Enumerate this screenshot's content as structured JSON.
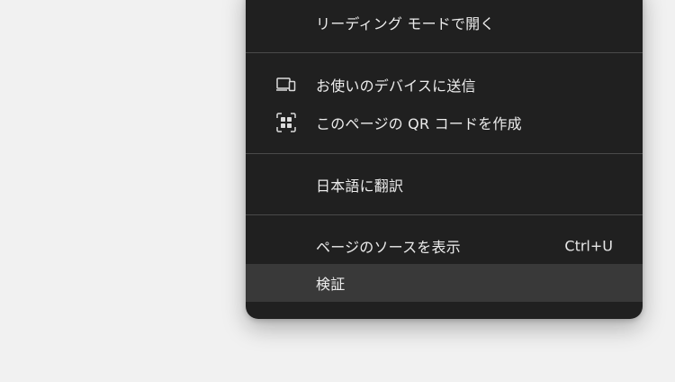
{
  "menu": {
    "items": [
      {
        "label": "リーディング モードで開く"
      },
      {
        "label": "お使いのデバイスに送信",
        "icon": "send-to-devices-icon"
      },
      {
        "label": "このページの QR コードを作成",
        "icon": "qr-code-icon"
      },
      {
        "label": "日本語に翻訳"
      },
      {
        "label": "ページのソースを表示",
        "shortcut": "Ctrl+U"
      },
      {
        "label": "検証"
      }
    ]
  },
  "colors": {
    "background": "#f1f1f1",
    "menu_background": "#202020",
    "hover": "#393939",
    "separator": "#4a4a4a",
    "text": "#ececec"
  }
}
